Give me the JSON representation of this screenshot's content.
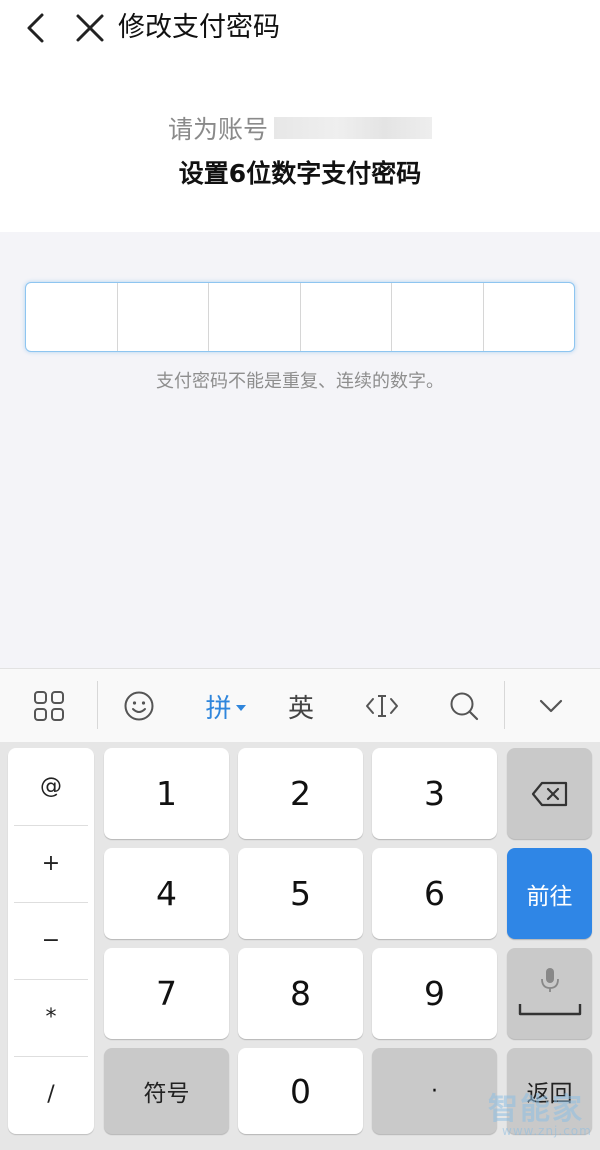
{
  "header": {
    "title": "修改支付密码",
    "back_icon": "chevron-left-icon",
    "close_icon": "close-icon"
  },
  "account": {
    "prompt": "请为账号",
    "instruction": "设置6位数字支付密码"
  },
  "pin": {
    "length": 6,
    "hint": "支付密码不能是重复、连续的数字。",
    "border_color": "#8ec5f0"
  },
  "keyboard_toolbar": {
    "items": [
      "grid-icon",
      "emoji-icon",
      "拼",
      "英",
      "cursor-icon",
      "search-icon",
      "chevron-down-icon"
    ],
    "pinyin_label": "拼",
    "english_label": "英",
    "active_color": "#2f86dc"
  },
  "keyboard": {
    "symbols": [
      "@",
      "+",
      "−",
      "*",
      "/"
    ],
    "digits": [
      "1",
      "2",
      "3",
      "4",
      "5",
      "6",
      "7",
      "8",
      "9",
      "0"
    ],
    "symbol_key": "符号",
    "dot_key": "·",
    "go_key": "前往",
    "back_key": "返回",
    "go_color": "#2f86e6"
  }
}
